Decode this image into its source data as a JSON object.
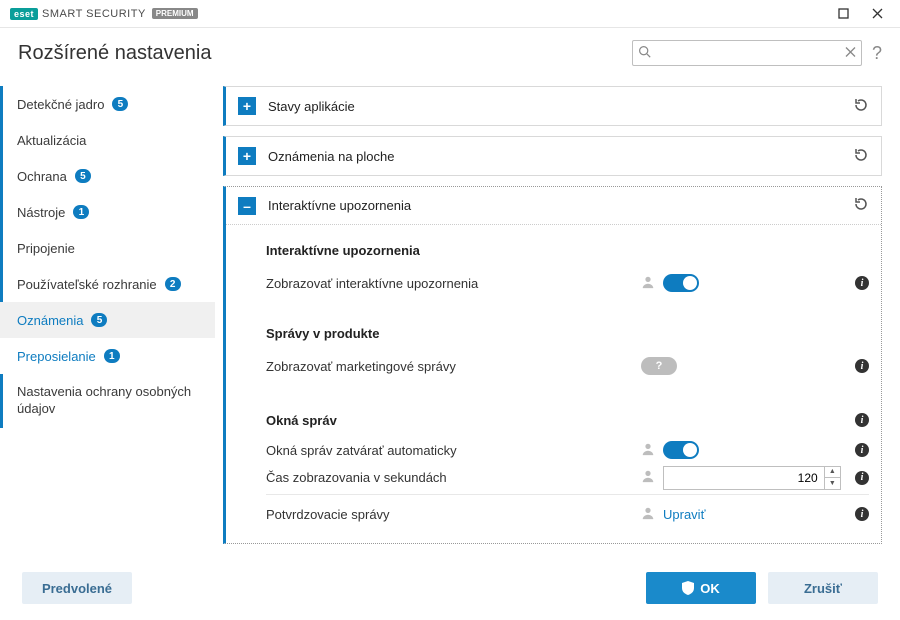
{
  "brand": {
    "eset": "eset",
    "product": "SMART SECURITY",
    "edition": "PREMIUM"
  },
  "header": {
    "title": "Rozšírené nastavenia",
    "search_placeholder": ""
  },
  "sidebar": {
    "items": [
      {
        "label": "Detekčné jadro",
        "badge": "5"
      },
      {
        "label": "Aktualizácia",
        "badge": ""
      },
      {
        "label": "Ochrana",
        "badge": "5"
      },
      {
        "label": "Nástroje",
        "badge": "1"
      },
      {
        "label": "Pripojenie",
        "badge": ""
      },
      {
        "label": "Používateľské rozhranie",
        "badge": "2"
      }
    ],
    "subs": [
      {
        "label": "Oznámenia",
        "badge": "5"
      },
      {
        "label": "Preposielanie",
        "badge": "1"
      }
    ],
    "static": {
      "label": "Nastavenia ochrany osobných údajov"
    }
  },
  "panels": {
    "p0": {
      "title": "Stavy aplikácie"
    },
    "p1": {
      "title": "Oznámenia na ploche"
    },
    "p2": {
      "title": "Interaktívne upozornenia",
      "sec1_title": "Interaktívne upozornenia",
      "row1": "Zobrazovať interaktívne upozornenia",
      "sec2_title": "Správy v produkte",
      "row2": "Zobrazovať marketingové správy",
      "sec3_title": "Okná správ",
      "row3": "Okná správ zatvárať automaticky",
      "row4": "Čas zobrazovania v sekundách",
      "row4_value": "120",
      "row5": "Potvrdzovacie správy",
      "row5_link": "Upraviť"
    }
  },
  "footer": {
    "default": "Predvolené",
    "ok": "OK",
    "cancel": "Zrušiť"
  }
}
